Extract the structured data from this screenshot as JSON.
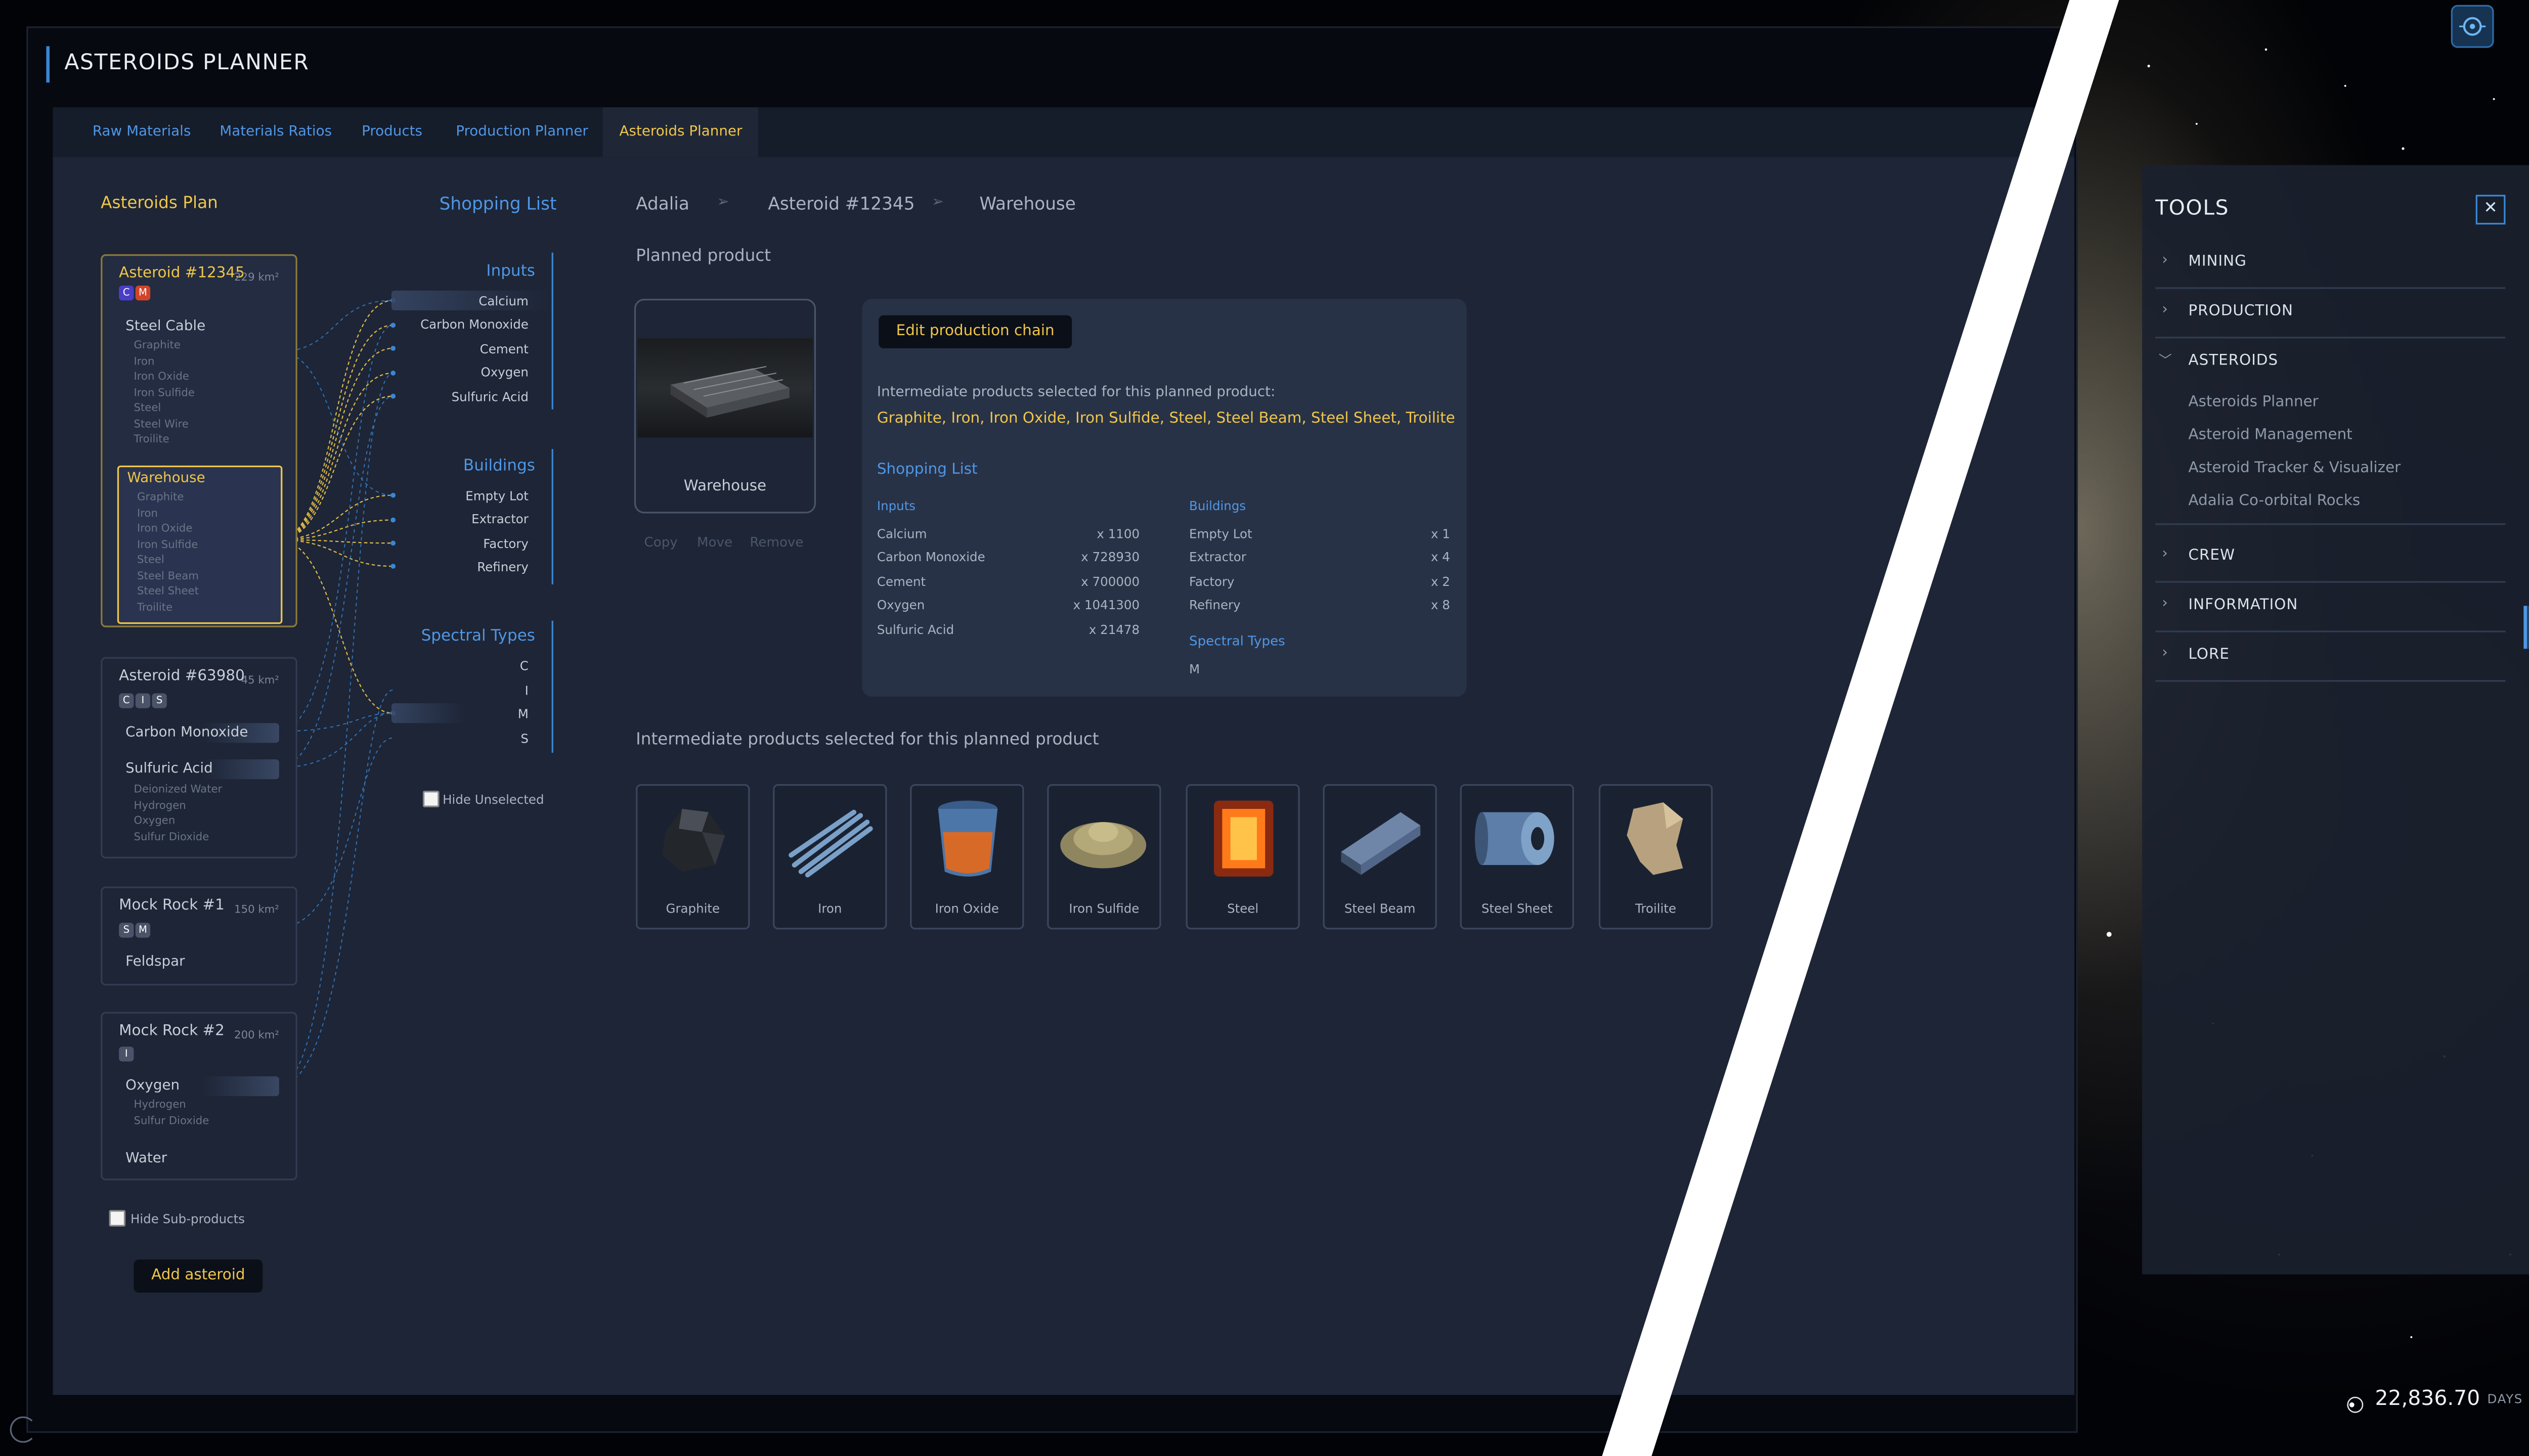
{
  "app": {
    "title": "ASTEROIDS PLANNER"
  },
  "tabs": [
    "Raw Materials",
    "Materials Ratios",
    "Products",
    "Production Planner",
    "Asteroids Planner"
  ],
  "left": {
    "plan_title": "Asteroids Plan",
    "shopping_link": "Shopping List",
    "asteroids": [
      {
        "name": "Asteroid #12345",
        "area": "229 km²",
        "badges": [
          "C",
          "M"
        ],
        "products": [
          {
            "name": "Steel Cable",
            "subs": [
              "Graphite",
              "Iron",
              "Iron Oxide",
              "Iron Sulfide",
              "Steel",
              "Steel Wire",
              "Troilite"
            ]
          },
          {
            "name": "Warehouse",
            "subs": [
              "Graphite",
              "Iron",
              "Iron Oxide",
              "Iron Sulfide",
              "Steel",
              "Steel Beam",
              "Steel Sheet",
              "Troilite"
            ]
          }
        ]
      },
      {
        "name": "Asteroid #63980",
        "area": "45 km²",
        "badges": [
          "C",
          "I",
          "S"
        ],
        "products": [
          {
            "name": "Carbon Monoxide",
            "subs": []
          },
          {
            "name": "Sulfuric Acid",
            "subs": [
              "Deionized Water",
              "Hydrogen",
              "Oxygen",
              "Sulfur Dioxide"
            ]
          }
        ]
      },
      {
        "name": "Mock Rock #1",
        "area": "150 km²",
        "badges": [
          "S",
          "M"
        ],
        "products": [
          {
            "name": "Feldspar",
            "subs": []
          }
        ]
      },
      {
        "name": "Mock Rock #2",
        "area": "200 km²",
        "badges": [
          "I"
        ],
        "products": [
          {
            "name": "Oxygen",
            "subs": [
              "Hydrogen",
              "Sulfur Dioxide"
            ]
          },
          {
            "name": "Water",
            "subs": []
          }
        ]
      }
    ],
    "hide_subproducts": "Hide Sub-products",
    "add_asteroid": "Add asteroid"
  },
  "nodes": {
    "inputs_title": "Inputs",
    "inputs": [
      "Calcium",
      "Carbon Monoxide",
      "Cement",
      "Oxygen",
      "Sulfuric Acid"
    ],
    "buildings_title": "Buildings",
    "buildings": [
      "Empty Lot",
      "Extractor",
      "Factory",
      "Refinery"
    ],
    "spectral_title": "Spectral Types",
    "spectral": [
      "C",
      "I",
      "M",
      "S"
    ],
    "hide_unselected": "Hide Unselected"
  },
  "detail": {
    "breadcrumb": [
      "Adalia",
      "Asteroid #12345",
      "Warehouse"
    ],
    "planned_product_label": "Planned product",
    "product_name": "Warehouse",
    "actions": [
      "Copy",
      "Move",
      "Remove"
    ],
    "edit_chain": "Edit production chain",
    "intermediate_note": "Intermediate products selected for this planned product:",
    "intermediate_list": "Graphite, Iron, Iron Oxide, Iron Sulfide, Steel, Steel Beam, Steel Sheet, Troilite",
    "shopping_title": "Shopping List",
    "inputs_head": "Inputs",
    "inputs": [
      {
        "name": "Calcium",
        "qty": "x 1100"
      },
      {
        "name": "Carbon Monoxide",
        "qty": "x 728930"
      },
      {
        "name": "Cement",
        "qty": "x 700000"
      },
      {
        "name": "Oxygen",
        "qty": "x 1041300"
      },
      {
        "name": "Sulfuric Acid",
        "qty": "x 21478"
      }
    ],
    "buildings_head": "Buildings",
    "buildings": [
      {
        "name": "Empty Lot",
        "qty": "x 1"
      },
      {
        "name": "Extractor",
        "qty": "x 4"
      },
      {
        "name": "Factory",
        "qty": "x 2"
      },
      {
        "name": "Refinery",
        "qty": "x 8"
      }
    ],
    "spectral_head": "Spectral Types",
    "spectral_value": "M",
    "intermediate_heading": "Intermediate products selected for this planned product",
    "tiles": [
      "Graphite",
      "Iron",
      "Iron Oxide",
      "Iron Sulfide",
      "Steel",
      "Steel Beam",
      "Steel Sheet",
      "Troilite"
    ]
  },
  "tools": {
    "title": "TOOLS",
    "sections": [
      "MINING",
      "PRODUCTION",
      "ASTEROIDS",
      "CREW",
      "INFORMATION",
      "LORE"
    ],
    "asteroids_items": [
      "Asteroids Planner",
      "Asteroid Management",
      "Asteroid Tracker & Visualizer",
      "Adalia Co-orbital Rocks"
    ]
  },
  "clock": {
    "value": "22,836.70",
    "unit": "DAYS"
  },
  "colors": {
    "accent_yellow": "#f0c64a",
    "accent_blue": "#4f97e6",
    "panel": "#1d2536"
  }
}
